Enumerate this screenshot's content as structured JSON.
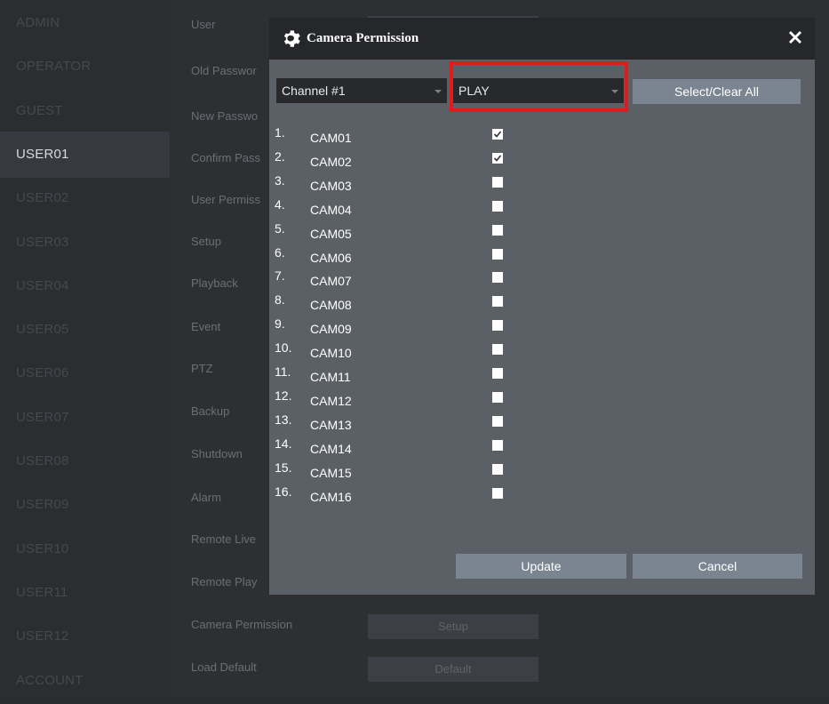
{
  "sidebar": {
    "items": [
      {
        "label": "ADMIN",
        "active": false
      },
      {
        "label": "OPERATOR",
        "active": false
      },
      {
        "label": "GUEST",
        "active": false
      },
      {
        "label": "USER01",
        "active": true
      },
      {
        "label": "USER02",
        "active": false
      },
      {
        "label": "USER03",
        "active": false
      },
      {
        "label": "USER04",
        "active": false
      },
      {
        "label": "USER05",
        "active": false
      },
      {
        "label": "USER06",
        "active": false
      },
      {
        "label": "USER07",
        "active": false
      },
      {
        "label": "USER08",
        "active": false
      },
      {
        "label": "USER09",
        "active": false
      },
      {
        "label": "USER10",
        "active": false
      },
      {
        "label": "USER11",
        "active": false
      },
      {
        "label": "USER12",
        "active": false
      },
      {
        "label": "ACCOUNT",
        "active": false
      }
    ]
  },
  "settings": {
    "labels": [
      "User",
      "Old Passwor",
      "New Passwo",
      "Confirm Pass",
      "User Permiss",
      "Setup",
      "Playback",
      "Event",
      "PTZ",
      "Backup",
      "Shutdown",
      "Alarm",
      "Remote Live",
      "Remote Play",
      "Camera Permission",
      "Load Default"
    ],
    "camera_permission_button": "Setup",
    "load_default_button": "Default"
  },
  "dialog": {
    "title": "Camera Permission",
    "channel_select": "Channel #1",
    "permission_select": "PLAY",
    "select_clear_all": "Select/Clear All",
    "update": "Update",
    "cancel": "Cancel",
    "cameras": [
      {
        "num": "1.",
        "name": "CAM01",
        "checked": true
      },
      {
        "num": "2.",
        "name": "CAM02",
        "checked": true
      },
      {
        "num": "3.",
        "name": "CAM03",
        "checked": false
      },
      {
        "num": "4.",
        "name": "CAM04",
        "checked": false
      },
      {
        "num": "5.",
        "name": "CAM05",
        "checked": false
      },
      {
        "num": "6.",
        "name": "CAM06",
        "checked": false
      },
      {
        "num": "7.",
        "name": "CAM07",
        "checked": false
      },
      {
        "num": "8.",
        "name": "CAM08",
        "checked": false
      },
      {
        "num": "9.",
        "name": "CAM09",
        "checked": false
      },
      {
        "num": "10.",
        "name": "CAM10",
        "checked": false
      },
      {
        "num": "11.",
        "name": "CAM11",
        "checked": false
      },
      {
        "num": "12.",
        "name": "CAM12",
        "checked": false
      },
      {
        "num": "13.",
        "name": "CAM13",
        "checked": false
      },
      {
        "num": "14.",
        "name": "CAM14",
        "checked": false
      },
      {
        "num": "15.",
        "name": "CAM15",
        "checked": false
      },
      {
        "num": "16.",
        "name": "CAM16",
        "checked": false
      }
    ]
  },
  "colors": {
    "highlight": "#e01b1b",
    "dialog_bg": "#5b6066",
    "button_bg": "#7a8591"
  }
}
